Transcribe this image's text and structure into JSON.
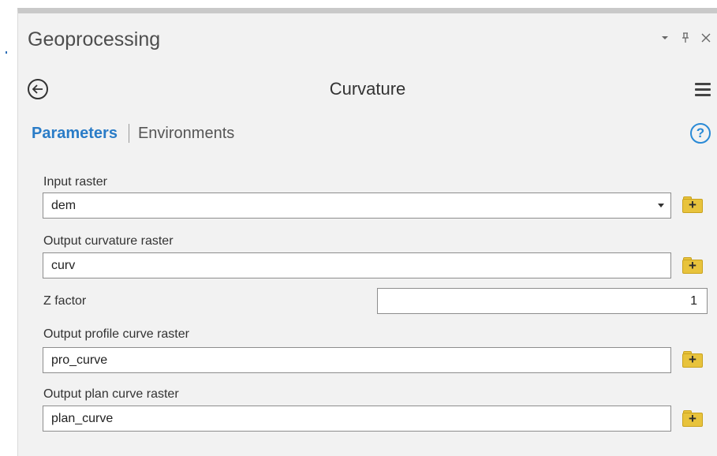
{
  "window": {
    "title": "Geoprocessing",
    "controls": [
      "dropdown-arrow",
      "pin",
      "close"
    ]
  },
  "tool": {
    "name": "Curvature"
  },
  "tabs": {
    "parameters": "Parameters",
    "environments": "Environments"
  },
  "params": {
    "input_raster": {
      "label": "Input raster",
      "value": "dem"
    },
    "output_curvature": {
      "label": "Output curvature raster",
      "value": "curv"
    },
    "z_factor": {
      "label": "Z factor",
      "value": "1"
    },
    "output_profile": {
      "label": "Output profile curve raster",
      "value": "pro_curve"
    },
    "output_plan": {
      "label": "Output plan curve raster",
      "value": "plan_curve"
    }
  },
  "icons": {
    "back": "back-arrow-circle-icon",
    "menu": "hamburger-menu-icon",
    "help": "question-circle-icon",
    "browse": "folder-plus-icon"
  },
  "colors": {
    "accent": "#2a7cc7",
    "panel_bg": "#f2f2f2",
    "folder": "#e8c33c"
  }
}
